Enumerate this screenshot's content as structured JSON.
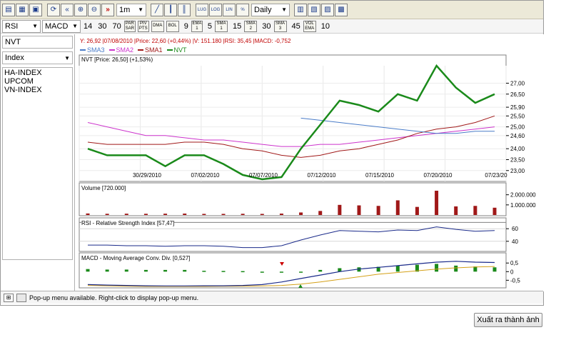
{
  "toolbar": {
    "period_value": "1m",
    "interval_value": "Daily",
    "btn_lug": "LUG",
    "btn_log": "LOG",
    "btn_lin": "LIN",
    "btn_pct": "%"
  },
  "indicators": {
    "rsi_label": "RSI",
    "rsi_values": [
      "14",
      "30",
      "70"
    ],
    "macd_label": "MACD",
    "par": "PAR SAR",
    "piv": "PIV PTS",
    "dma": "DMA",
    "bol": "BOL",
    "bol_value": "9",
    "ema": "EMA 1",
    "ema_value": "5",
    "sma1": "SMA 1",
    "sma1_value": "15",
    "sma2": "SMA 2",
    "sma2_value": "30",
    "sma3": "SMA 3",
    "sma3_value": "45",
    "vol": "VOL EMA",
    "vol_value": "10"
  },
  "sidebar": {
    "symbol": "NVT",
    "category": "Index",
    "items": [
      "HA-INDEX",
      "UPCOM",
      "VN-INDEX"
    ]
  },
  "info_line": "Y: 26,92 |07/08/2010 |Price: 22,60 (+0,44%) |V: 151.180 |RSI: 35,45 |MACD: -0,752",
  "legend": [
    {
      "name": "SMA3",
      "color": "#4a7cc8"
    },
    {
      "name": "SMA2",
      "color": "#cc33cc"
    },
    {
      "name": "SMA1",
      "color": "#a01818"
    },
    {
      "name": "NVT",
      "color": "#1a8a1a"
    }
  ],
  "main_title": "NVT [Price: 26,50] (+1,53%)",
  "volume_title": "Volume [720.000]",
  "rsi_title": "RSI - Relative Strength Index [57,47]",
  "macd_title": "MACD - Moving Average Conv. Div. [0,527]",
  "status_text": "Pop-up menu available. Right-click to display pop-up menu.",
  "export_button": "Xuất ra thành ảnh",
  "chart_data": {
    "type": "line",
    "x_tick_labels": [
      "30/29/2010",
      "07/02/2010",
      "07/07/2010",
      "07/12/2010",
      "07/15/2010",
      "07/20/2010",
      "07/23/20"
    ],
    "price_axis_labels": [
      "27,00",
      "26,50",
      "25,90",
      "25,50",
      "25,00",
      "24,60",
      "24,00",
      "23,50",
      "23,00"
    ],
    "price_ylim": [
      22.6,
      27.8
    ],
    "nvt_close": [
      24.0,
      23.7,
      23.7,
      23.7,
      23.2,
      23.7,
      23.7,
      23.3,
      22.8,
      22.6,
      22.7,
      24.0,
      25.1,
      26.2,
      26.0,
      25.7,
      26.5,
      26.2,
      27.8,
      26.8,
      26.1,
      26.5
    ],
    "sma1": [
      24.3,
      24.2,
      24.2,
      24.2,
      24.2,
      24.3,
      24.3,
      24.2,
      24.0,
      23.9,
      23.7,
      23.6,
      23.7,
      23.9,
      24.0,
      24.2,
      24.4,
      24.7,
      24.9,
      25.0,
      25.2,
      25.5
    ],
    "sma2": [
      25.2,
      25.0,
      24.8,
      24.6,
      24.6,
      24.5,
      24.4,
      24.4,
      24.3,
      24.2,
      24.1,
      24.1,
      24.2,
      24.2,
      24.3,
      24.4,
      24.5,
      24.6,
      24.7,
      24.8,
      24.9,
      25.0
    ],
    "sma3_x_start_index": 11,
    "sma3": [
      25.4,
      25.3,
      25.2,
      25.1,
      25.0,
      24.9,
      24.8,
      24.7,
      24.7,
      24.8,
      24.8
    ],
    "volume_axis_labels": [
      "2.000.000",
      "1.000.000"
    ],
    "volume_ymax": 2400000,
    "volume": [
      150000,
      120000,
      130000,
      120000,
      130000,
      140000,
      110000,
      110000,
      120000,
      110000,
      140000,
      250000,
      400000,
      1000000,
      950000,
      900000,
      1450000,
      800000,
      2400000,
      850000,
      900000,
      720000
    ],
    "rsi_axis_labels": [
      "60",
      "40"
    ],
    "rsi_ylim": [
      25,
      75
    ],
    "rsi_x_start_index": 0,
    "rsi": [
      34,
      34,
      33,
      33,
      32,
      33,
      33,
      32,
      30,
      30,
      33,
      42,
      50,
      57,
      56,
      55,
      58,
      57,
      63,
      59,
      56,
      57
    ],
    "macd_axis_labels": [
      "0,5",
      "0",
      "-0,5"
    ],
    "macd_ylim": [
      -0.9,
      0.8
    ],
    "macd_hist": [
      0.15,
      0.12,
      0.12,
      0.1,
      0.1,
      0.1,
      0.05,
      0.04,
      0.03,
      0.0,
      0.0,
      0.0,
      0.1,
      0.2,
      0.25,
      0.28,
      0.35,
      0.4,
      0.45,
      0.35,
      0.3,
      0.25
    ],
    "macd_line": [
      -0.75,
      -0.78,
      -0.8,
      -0.82,
      -0.83,
      -0.83,
      -0.82,
      -0.82,
      -0.8,
      -0.75,
      -0.6,
      -0.4,
      -0.2,
      0.0,
      0.15,
      0.25,
      0.35,
      0.45,
      0.55,
      0.6,
      0.55,
      0.53
    ],
    "macd_signal": [
      -0.8,
      -0.82,
      -0.84,
      -0.86,
      -0.86,
      -0.86,
      -0.86,
      -0.85,
      -0.84,
      -0.83,
      -0.8,
      -0.72,
      -0.6,
      -0.45,
      -0.3,
      -0.15,
      -0.05,
      0.05,
      0.15,
      0.22,
      0.27,
      0.3
    ]
  }
}
